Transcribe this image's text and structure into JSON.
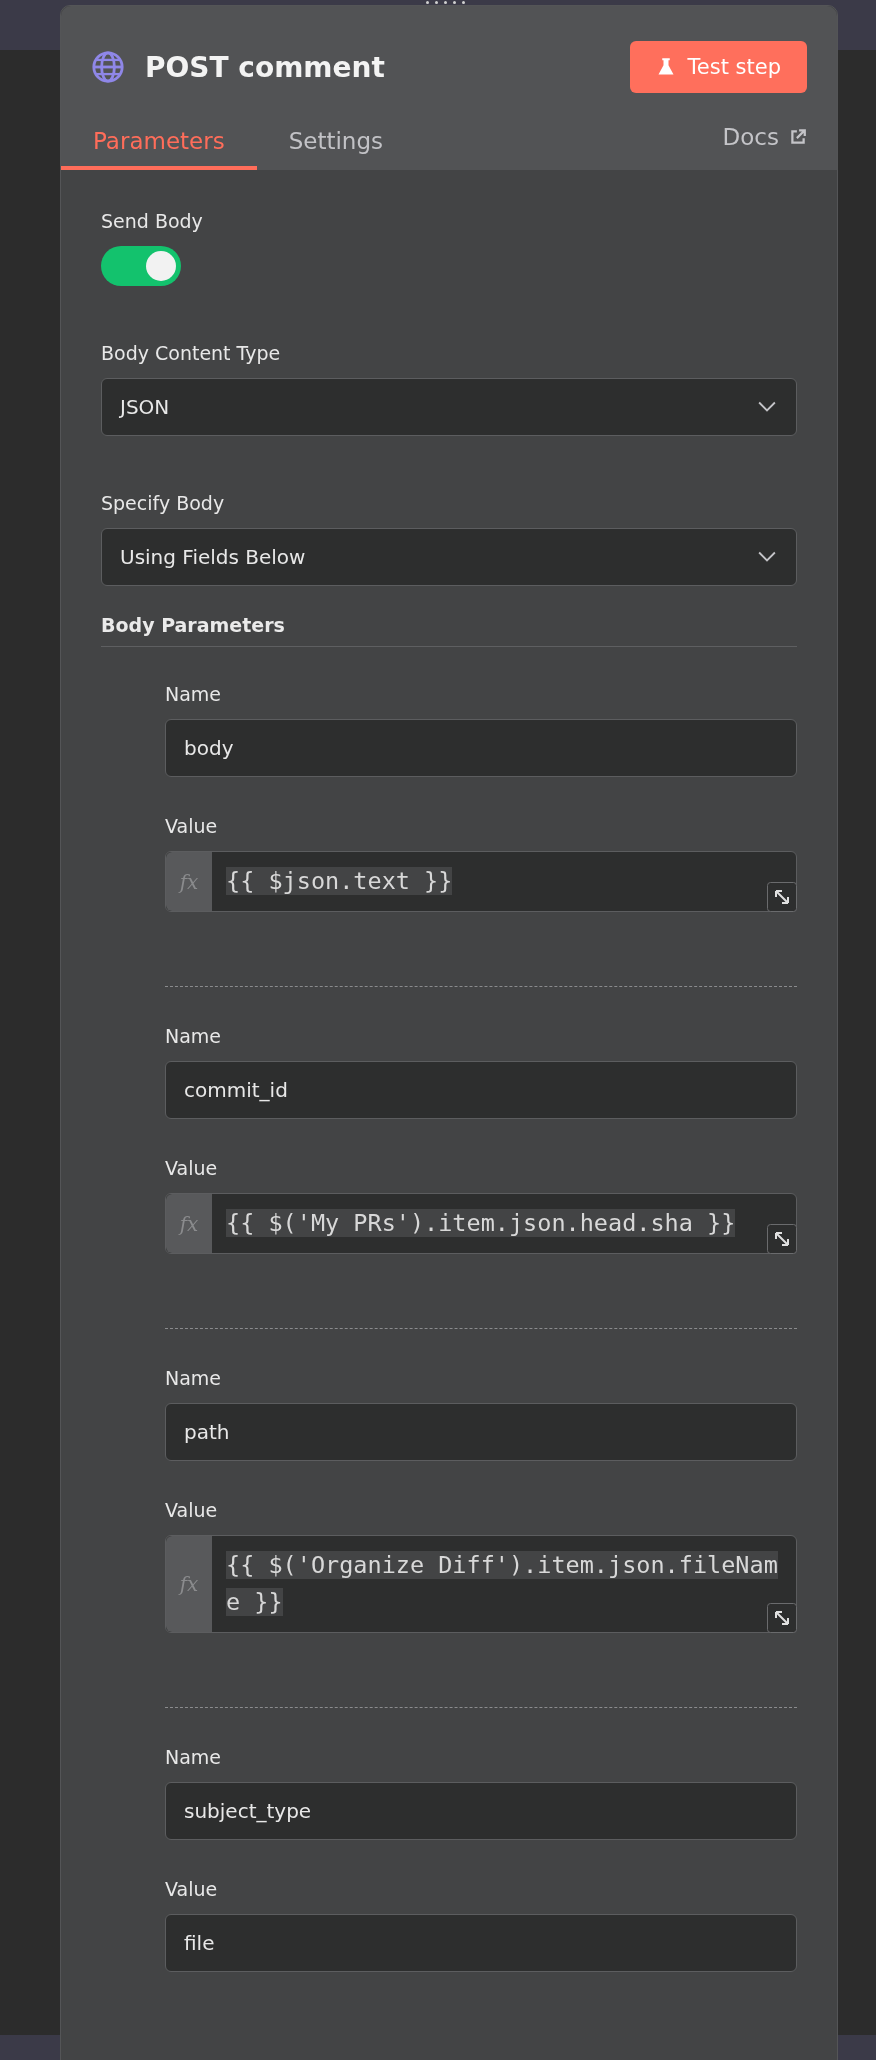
{
  "header": {
    "title": "POST comment",
    "test_button": "Test step"
  },
  "tabs": [
    {
      "label": "Parameters",
      "selected": true
    },
    {
      "label": "Settings",
      "selected": false
    }
  ],
  "docs_link": "Docs",
  "send_body": {
    "label": "Send Body",
    "on": true
  },
  "body_content_type": {
    "label": "Body Content Type",
    "value": "JSON"
  },
  "specify_body": {
    "label": "Specify Body",
    "value": "Using Fields Below"
  },
  "body_parameters": {
    "title": "Body Parameters",
    "items": [
      {
        "kind": "expression",
        "name_label": "Name",
        "name": "body",
        "value_label": "Value",
        "fx_label": "fx",
        "value": "{{ $json.text }}"
      },
      {
        "kind": "expression",
        "name_label": "Name",
        "name": "commit_id",
        "value_label": "Value",
        "fx_label": "fx",
        "value": "{{ $('My PRs').item.json.head.sha }}"
      },
      {
        "kind": "expression",
        "name_label": "Name",
        "name": "path",
        "value_label": "Value",
        "fx_label": "fx",
        "value": "{{ $('Organize Diff').item.json.fileName }}"
      },
      {
        "kind": "text",
        "name_label": "Name",
        "name": "subject_type",
        "value_label": "Value",
        "value": "file"
      }
    ]
  }
}
